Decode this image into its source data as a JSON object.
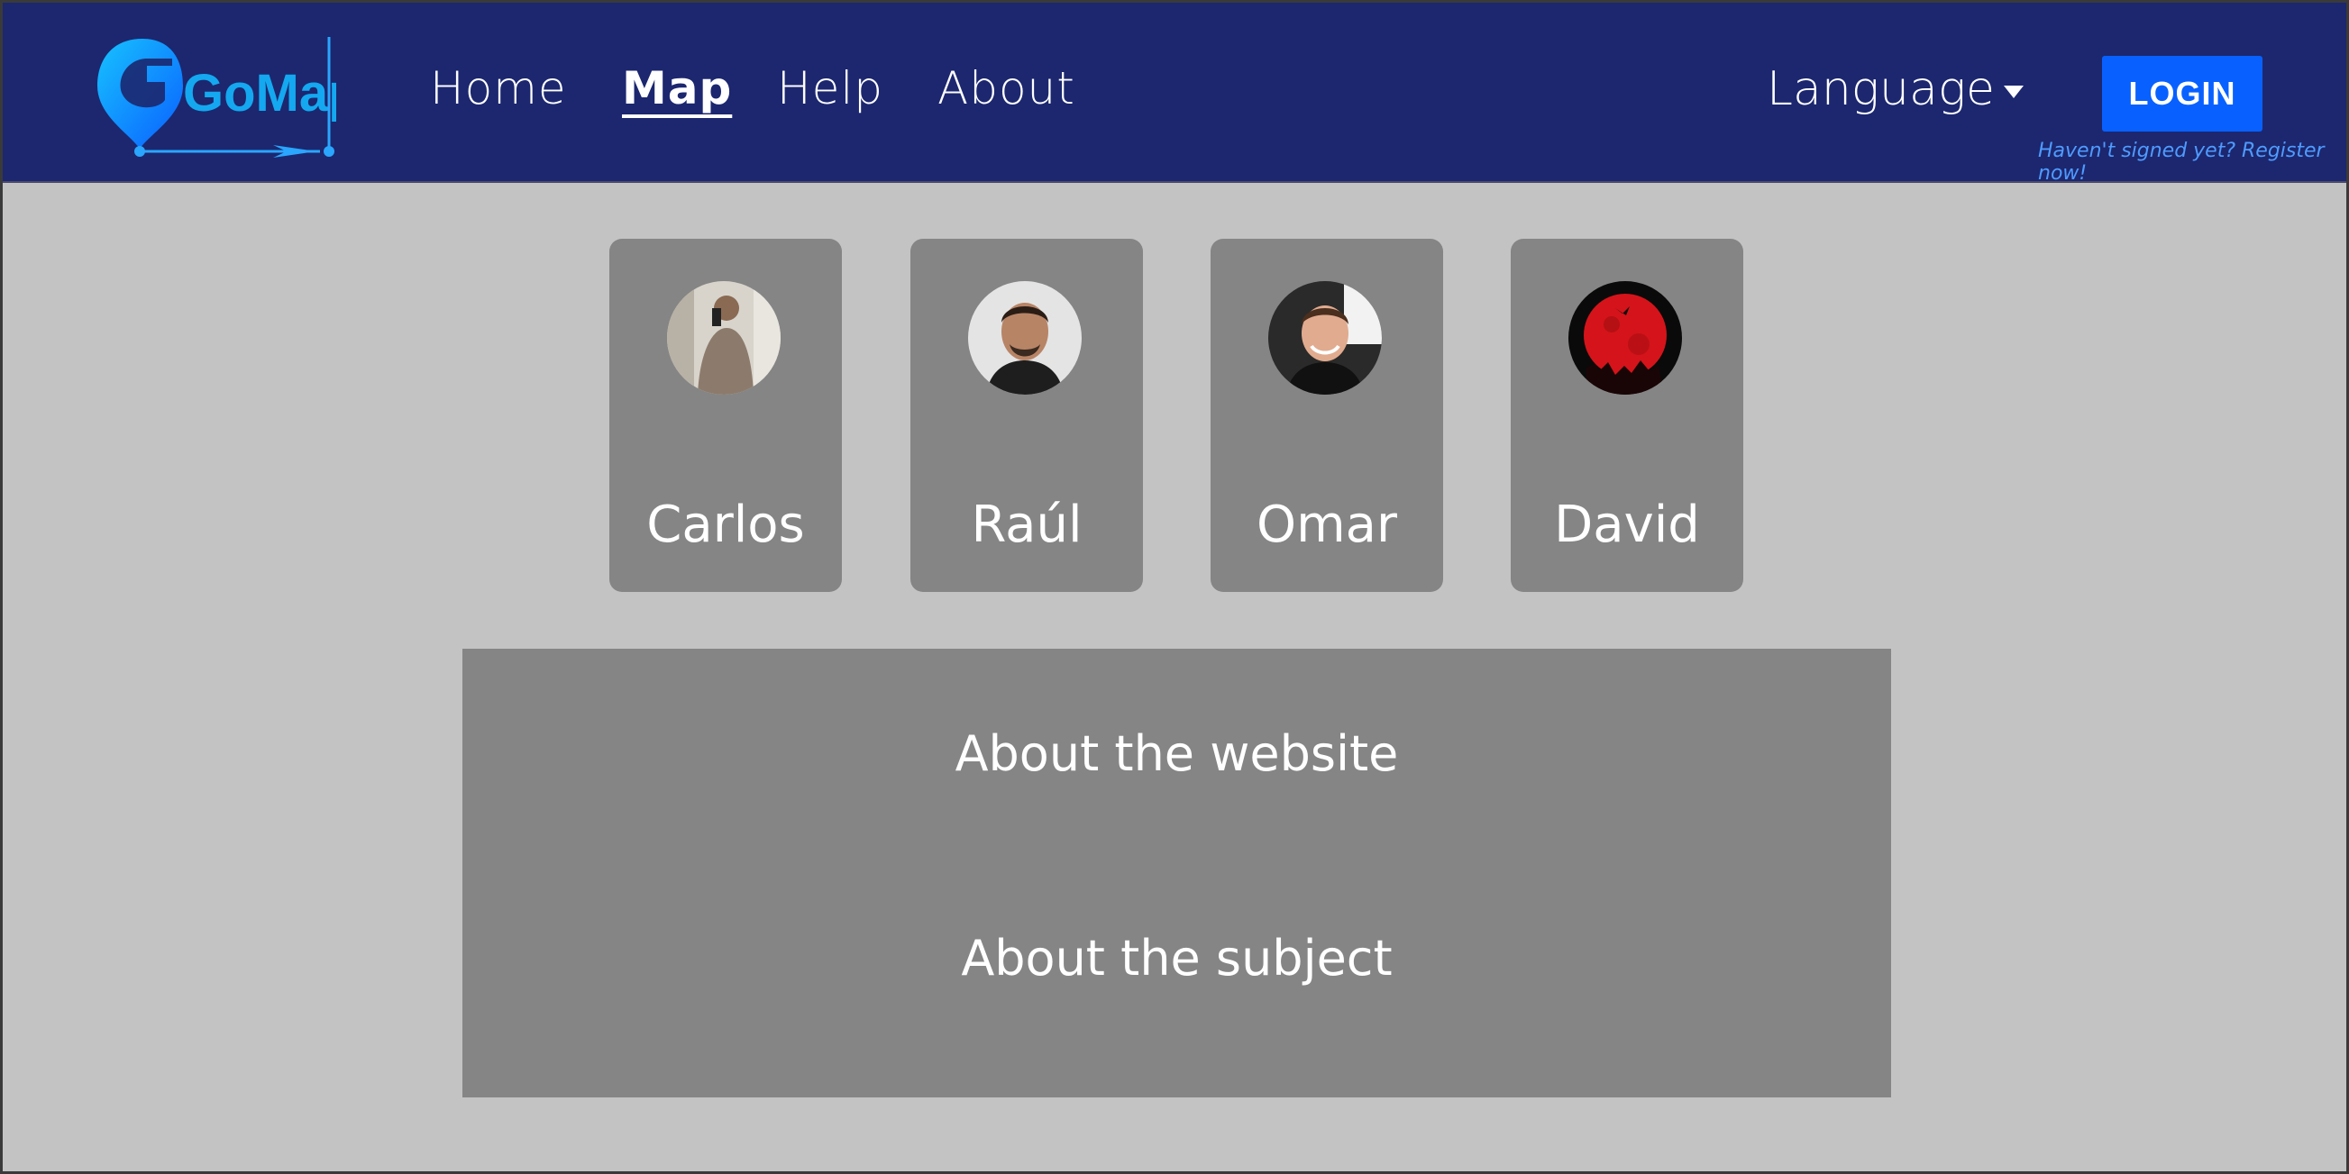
{
  "header": {
    "logo_text": "GoMap",
    "nav": [
      {
        "label": "Home"
      },
      {
        "label": "Map"
      },
      {
        "label": "Help"
      },
      {
        "label": "About"
      }
    ],
    "language_label": "Language",
    "login_label": "LOGIN",
    "register_text": "Haven't signed yet? Register now!"
  },
  "team": [
    {
      "name": "Carlos"
    },
    {
      "name": "Raúl"
    },
    {
      "name": "Omar"
    },
    {
      "name": "David"
    }
  ],
  "about": {
    "website": "About the website",
    "subject": "About the subject"
  },
  "colors": {
    "header_bg": "#1c276f",
    "page_bg": "#c3c3c3",
    "card_bg": "#858585",
    "accent": "#0861ff",
    "logo": "#14a8f0"
  }
}
